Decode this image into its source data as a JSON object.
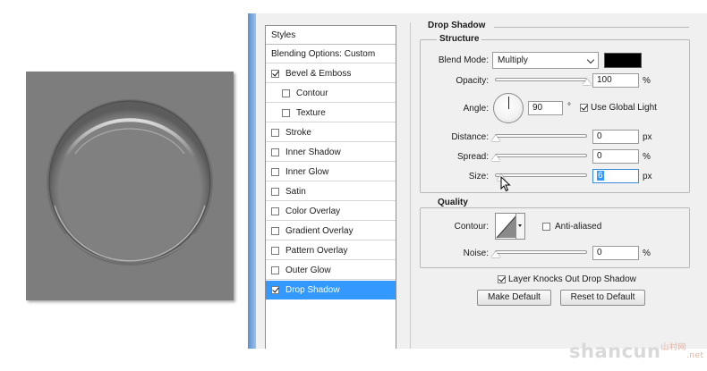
{
  "styles_panel": {
    "header": "Styles",
    "items": [
      {
        "label": "Blending Options: Custom",
        "checkbox": false,
        "checked": false,
        "indent": 0
      },
      {
        "label": "Bevel & Emboss",
        "checkbox": true,
        "checked": true,
        "indent": 0
      },
      {
        "label": "Contour",
        "checkbox": true,
        "checked": false,
        "indent": 1
      },
      {
        "label": "Texture",
        "checkbox": true,
        "checked": false,
        "indent": 1
      },
      {
        "label": "Stroke",
        "checkbox": true,
        "checked": false,
        "indent": 0
      },
      {
        "label": "Inner Shadow",
        "checkbox": true,
        "checked": false,
        "indent": 0
      },
      {
        "label": "Inner Glow",
        "checkbox": true,
        "checked": false,
        "indent": 0
      },
      {
        "label": "Satin",
        "checkbox": true,
        "checked": false,
        "indent": 0
      },
      {
        "label": "Color Overlay",
        "checkbox": true,
        "checked": false,
        "indent": 0
      },
      {
        "label": "Gradient Overlay",
        "checkbox": true,
        "checked": false,
        "indent": 0
      },
      {
        "label": "Pattern Overlay",
        "checkbox": true,
        "checked": false,
        "indent": 0
      },
      {
        "label": "Outer Glow",
        "checkbox": true,
        "checked": false,
        "indent": 0
      },
      {
        "label": "Drop Shadow",
        "checkbox": true,
        "checked": true,
        "indent": 0,
        "selected": true
      }
    ]
  },
  "drop_shadow": {
    "title": "Drop Shadow",
    "structure": {
      "title": "Structure",
      "blend_mode_label": "Blend Mode:",
      "blend_mode_value": "Multiply",
      "shadow_color": "#000000",
      "opacity_label": "Opacity:",
      "opacity_value": "100",
      "opacity_unit": "%",
      "opacity_fraction": 1.0,
      "angle_label": "Angle:",
      "angle_value": "90",
      "angle_unit": "°",
      "use_global_light_label": "Use Global Light",
      "use_global_light_checked": true,
      "distance_label": "Distance:",
      "distance_value": "0",
      "distance_unit": "px",
      "spread_label": "Spread:",
      "spread_value": "0",
      "spread_unit": "%",
      "size_label": "Size:",
      "size_value": "6",
      "size_unit": "px"
    },
    "quality": {
      "title": "Quality",
      "contour_label": "Contour:",
      "anti_aliased_label": "Anti-aliased",
      "anti_aliased_checked": false,
      "noise_label": "Noise:",
      "noise_value": "0",
      "noise_unit": "%"
    },
    "layer_knocks_out_label": "Layer Knocks Out Drop Shadow",
    "layer_knocks_out_checked": true,
    "make_default_label": "Make Default",
    "reset_to_default_label": "Reset to Default"
  },
  "watermark": {
    "main": "shancun",
    "cn": "山村网",
    "net": ".net"
  },
  "colors": {
    "selection": "#3399ff",
    "dialog_bg": "#f0f0f0",
    "preview_bg": "#7d7d7d"
  }
}
